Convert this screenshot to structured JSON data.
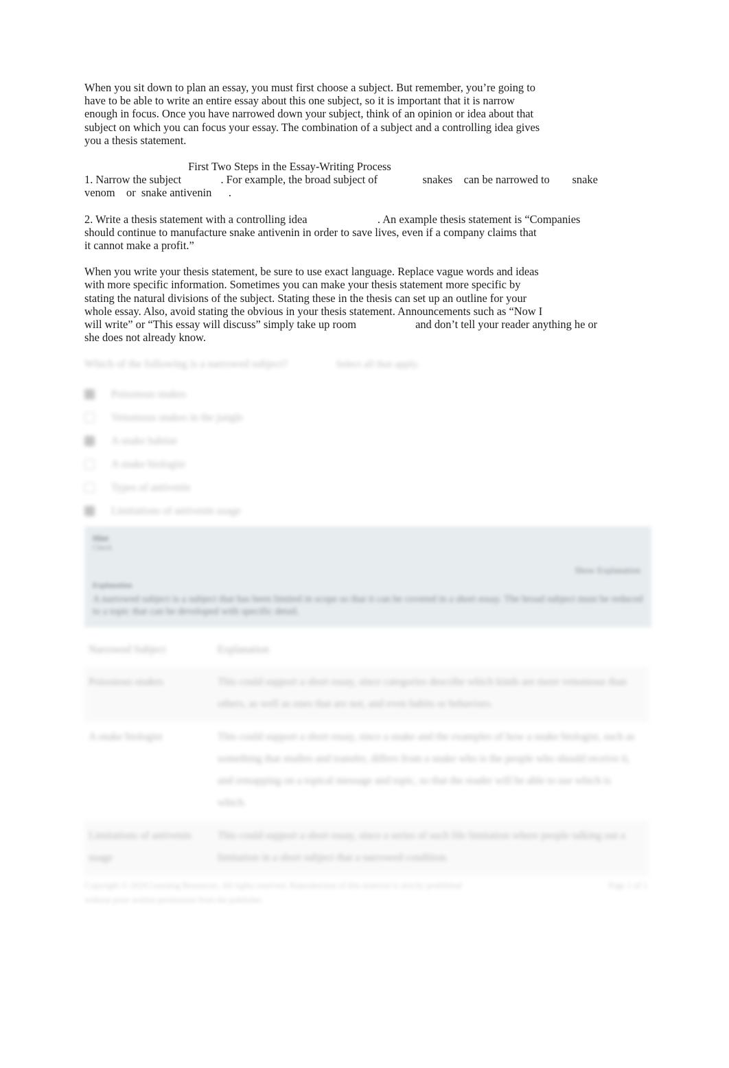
{
  "passage": {
    "intro": "When you sit down to plan an essay, you must first choose a subject. But remember, you’re going to\nhave to be able to write an entire essay about this one subject, so it is important that it is narrow\nenough in focus. Once you have narrowed down your subject, think of an opinion or idea about that\nsubject on which you can focus your essay. The combination of a subject and a controlling idea gives\nyou a thesis statement.",
    "process_heading": "First Two Steps in the Essay-Writing Process",
    "step_one": "1. Narrow the subject              . For example, the broad subject of                snakes    can be narrowed to        snake\nvenom    or  snake antivenin      .",
    "step_two": "2. Write a thesis statement with a controlling idea                         . An example thesis statement is “Companies\nshould continue to manufacture snake antivenin in order to save lives, even if a company claims that\nit cannot make a profit.”",
    "exact_language": "When you write your thesis statement, be sure to use exact language. Replace vague words and ideas\nwith more specific information. Sometimes you can make your thesis statement more specific by\nstating the natural divisions of the subject. Stating these in the thesis can set up an outline for your\nwhole essay. Also, avoid stating the obvious in your thesis statement. Announcements such as “Now I\nwill write” or “This essay will discuss” simply take up room                     and don’t tell your reader anything he or\nshe does not already know."
  },
  "question": {
    "prompt": "Which of the following is a narrowed subject?",
    "side_note": "Select all that apply.",
    "options": [
      {
        "label": "Poisonous snakes",
        "checked": true
      },
      {
        "label": "Venomous snakes in the jungle",
        "checked": false
      },
      {
        "label": "A snake habitat",
        "checked": true
      },
      {
        "label": "A snake biologist",
        "checked": false
      },
      {
        "label": "Types of antivenin",
        "checked": false
      },
      {
        "label": "Limitations of antivenin usage",
        "checked": true
      }
    ]
  },
  "explanation_panel": {
    "tag": "Hint",
    "tag_sub": "Check",
    "link": "Show Explanation",
    "sub_label": "Explanation",
    "body": "A narrowed subject is a subject that has been limited in scope so that it can be covered in a short essay. The broad subject must be reduced to a topic that can be developed with specific detail."
  },
  "table": {
    "headers": [
      "Narrowed Subject",
      "Explanation"
    ],
    "rows": [
      {
        "subject": "Poisonous snakes",
        "explanation": "This could support a short essay, since categories describe which kinds are more venomous than others, as well as ones that are not, and even habits or behaviors."
      },
      {
        "subject": "A snake biologist",
        "explanation": "This could support a short essay, since a snake and the examples of how a snake biologist, such as something that studies and transfer, differs from a snake who is the people who should receive it, and remapping on a topical message and topic, so that the reader will be able to use which is which."
      },
      {
        "subject": "Limitations of antivenin usage",
        "explanation": "This could support a short essay, since a series of such life limitation where people talking out a limitation in a short subject that a narrowed condition."
      }
    ]
  },
  "footer": {
    "left": "Copyright © 2024 Learning Resources. All rights reserved. Reproduction of this material\nis strictly prohibited without prior written permission from the publisher.",
    "right": "Page 1 of 1"
  }
}
